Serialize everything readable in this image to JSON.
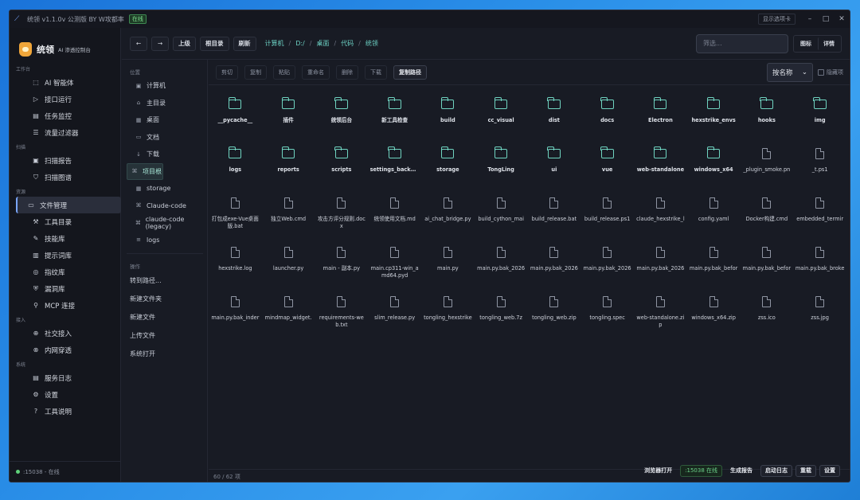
{
  "window": {
    "title": "统领 v1.1.0v 公测版 BY W攻都率",
    "status_tag": "在线",
    "menu_toggle": "显示选项卡",
    "min": "–",
    "max": "□",
    "close": "✕"
  },
  "brand": {
    "name": "统领",
    "subtitle": "AI 渗透控制台"
  },
  "sidebar": {
    "sections": [
      {
        "title": "工作台",
        "items": [
          {
            "label": "AI 智能体",
            "icon": "robot-icon",
            "glyph": "⬚"
          },
          {
            "label": "接口运行",
            "icon": "play-icon",
            "glyph": "▷"
          },
          {
            "label": "任务监控",
            "icon": "monitor-icon",
            "glyph": "▤"
          },
          {
            "label": "流量过滤器",
            "icon": "filter-icon",
            "glyph": "☰"
          }
        ]
      },
      {
        "title": "扫描",
        "items": [
          {
            "label": "扫描报告",
            "icon": "report-icon",
            "glyph": "▣"
          },
          {
            "label": "扫描图谱",
            "icon": "funnel-icon",
            "glyph": "⛉"
          }
        ]
      },
      {
        "title": "资源",
        "items": [
          {
            "label": "文件管理",
            "icon": "folder-icon",
            "glyph": "▭",
            "active": true
          },
          {
            "label": "工具目录",
            "icon": "wrench-icon",
            "glyph": "⚒"
          },
          {
            "label": "技能库",
            "icon": "puzzle-icon",
            "glyph": "✎"
          },
          {
            "label": "提示词库",
            "icon": "prompt-icon",
            "glyph": "▥"
          },
          {
            "label": "指纹库",
            "icon": "fingerprint-icon",
            "glyph": "◎"
          },
          {
            "label": "漏洞库",
            "icon": "shield-icon",
            "glyph": "⛨"
          },
          {
            "label": "MCP 连接",
            "icon": "plug-icon",
            "glyph": "⚲"
          }
        ]
      },
      {
        "title": "接入",
        "items": [
          {
            "label": "社交接入",
            "icon": "social-icon",
            "glyph": "⊕"
          },
          {
            "label": "内网穿透",
            "icon": "tunnel-icon",
            "glyph": "⊗"
          }
        ]
      },
      {
        "title": "系统",
        "items": [
          {
            "label": "服务日志",
            "icon": "log-icon",
            "glyph": "▤"
          },
          {
            "label": "设置",
            "icon": "gear-icon",
            "glyph": "⚙"
          },
          {
            "label": "工具说明",
            "icon": "help-icon",
            "glyph": "?"
          }
        ]
      }
    ],
    "footer": ":15038 - 在线"
  },
  "toolbar": {
    "back": "←",
    "forward": "→",
    "up": "上级",
    "root": "根目录",
    "refresh": "刷新",
    "crumbs": [
      "计算机",
      "D:/",
      "桌面",
      "代码",
      "统领"
    ],
    "filter_placeholder": "筛选...",
    "view_icons": "图标",
    "view_details": "详情"
  },
  "places": {
    "title": "位置",
    "items": [
      {
        "label": "计算机",
        "glyph": "▣",
        "icon": "computer-icon"
      },
      {
        "label": "主目录",
        "glyph": "⌂",
        "icon": "home-icon"
      },
      {
        "label": "桌面",
        "glyph": "▦",
        "icon": "desktop-icon"
      },
      {
        "label": "文档",
        "glyph": "▭",
        "icon": "document-icon"
      },
      {
        "label": "下载",
        "glyph": "↓",
        "icon": "download-icon"
      },
      {
        "label": "项目根",
        "glyph": "⌘",
        "icon": "project-icon",
        "active": true
      },
      {
        "label": "storage",
        "glyph": "▦",
        "icon": "storage-icon"
      },
      {
        "label": "Claude-code",
        "glyph": "⌘",
        "icon": "bookmark-icon"
      },
      {
        "label": "claude-code (legacy)",
        "glyph": "⌘",
        "icon": "bookmark-icon"
      },
      {
        "label": "logs",
        "glyph": "≡",
        "icon": "logs-icon"
      }
    ],
    "actions_title": "操作",
    "actions": [
      "转到路径...",
      "新建文件夹",
      "新建文件",
      "上传文件",
      "系统打开"
    ]
  },
  "actions": {
    "buttons": [
      "剪切",
      "复制",
      "粘贴",
      "重命名",
      "删除",
      "下载",
      "复制路径"
    ],
    "sort": "按名称",
    "show_hidden": "隐藏项"
  },
  "files": [
    {
      "name": "__pycache__",
      "type": "folder"
    },
    {
      "name": "插件",
      "type": "folder"
    },
    {
      "name": "统领后台",
      "type": "folder"
    },
    {
      "name": "新工具检查",
      "type": "folder"
    },
    {
      "name": "build",
      "type": "folder"
    },
    {
      "name": "cc_visual",
      "type": "folder"
    },
    {
      "name": "dist",
      "type": "folder"
    },
    {
      "name": "docs",
      "type": "folder"
    },
    {
      "name": "Electron",
      "type": "folder"
    },
    {
      "name": "hexstrike_envs",
      "type": "folder"
    },
    {
      "name": "hooks",
      "type": "folder"
    },
    {
      "name": "img",
      "type": "folder"
    },
    {
      "name": "logs",
      "type": "folder"
    },
    {
      "name": "reports",
      "type": "folder"
    },
    {
      "name": "scripts",
      "type": "folder"
    },
    {
      "name": "settings_backups",
      "type": "folder"
    },
    {
      "name": "storage",
      "type": "folder"
    },
    {
      "name": "TongLing",
      "type": "folder"
    },
    {
      "name": "ui",
      "type": "folder"
    },
    {
      "name": "vue",
      "type": "folder"
    },
    {
      "name": "web-standalone",
      "type": "folder"
    },
    {
      "name": "windows_x64",
      "type": "folder"
    },
    {
      "name": "_plugin_smoke.pn",
      "type": "file"
    },
    {
      "name": "_t.ps1",
      "type": "file"
    },
    {
      "name": "打包成exe-Vue桌面版.bat",
      "type": "file",
      "wrap": true
    },
    {
      "name": "独立Web.cmd",
      "type": "file"
    },
    {
      "name": "攻击方评分规则.docx",
      "type": "file",
      "wrap": true
    },
    {
      "name": "统领使用文档.md",
      "type": "file"
    },
    {
      "name": "ai_chat_bridge.py",
      "type": "file"
    },
    {
      "name": "build_cython_mai",
      "type": "file"
    },
    {
      "name": "build_release.bat",
      "type": "file"
    },
    {
      "name": "build_release.ps1",
      "type": "file"
    },
    {
      "name": "claude_hexstrike_l",
      "type": "file"
    },
    {
      "name": "config.yaml",
      "type": "file"
    },
    {
      "name": "Docker构建.cmd",
      "type": "file"
    },
    {
      "name": "embedded_termir",
      "type": "file"
    },
    {
      "name": "hexstrike.log",
      "type": "file"
    },
    {
      "name": "launcher.py",
      "type": "file"
    },
    {
      "name": "main - 副本.py",
      "type": "file"
    },
    {
      "name": "main.cp311-win_amd64.pyd",
      "type": "file",
      "wrap": true
    },
    {
      "name": "main.py",
      "type": "file"
    },
    {
      "name": "main.py.bak_2026",
      "type": "file"
    },
    {
      "name": "main.py.bak_2026",
      "type": "file"
    },
    {
      "name": "main.py.bak_2026",
      "type": "file"
    },
    {
      "name": "main.py.bak_2026",
      "type": "file"
    },
    {
      "name": "main.py.bak_befor",
      "type": "file"
    },
    {
      "name": "main.py.bak_befor",
      "type": "file"
    },
    {
      "name": "main.py.bak_broke",
      "type": "file"
    },
    {
      "name": "main.py.bak_inder",
      "type": "file"
    },
    {
      "name": "mindmap_widget.",
      "type": "file"
    },
    {
      "name": "requirements-web.txt",
      "type": "file",
      "wrap": true
    },
    {
      "name": "slim_release.py",
      "type": "file"
    },
    {
      "name": "tongling_hexstrike",
      "type": "file"
    },
    {
      "name": "tongling_web.7z",
      "type": "file"
    },
    {
      "name": "tongling_web.zip",
      "type": "file"
    },
    {
      "name": "tongling.spec",
      "type": "file"
    },
    {
      "name": "web-standalone.zip",
      "type": "file",
      "wrap": true
    },
    {
      "name": "windows_x64.zip",
      "type": "file"
    },
    {
      "name": "zss.ico",
      "type": "file"
    },
    {
      "name": "zss.jpg",
      "type": "file"
    }
  ],
  "status": {
    "count": "60 / 62 项"
  },
  "bottom": {
    "open_browser": "浏览器打开",
    "port_status": ":15038 在线",
    "gen_report": "生成报告",
    "start_log": "启动日志",
    "restart": "重载",
    "settings": "设置"
  }
}
